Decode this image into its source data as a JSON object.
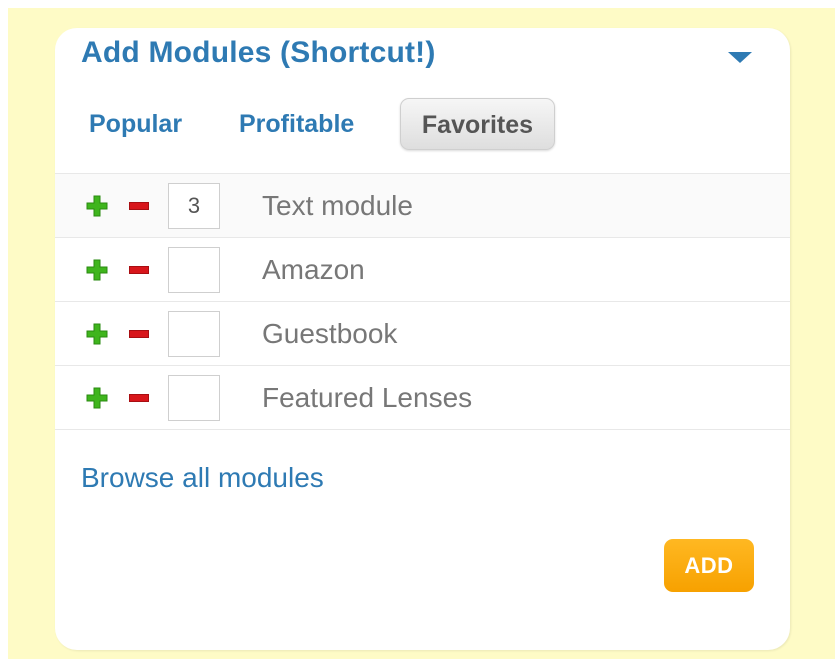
{
  "panel": {
    "title": "Add Modules (Shortcut!)",
    "collapse_icon": "triangle-down-icon"
  },
  "tabs": [
    {
      "label": "Popular",
      "active": false
    },
    {
      "label": "Profitable",
      "active": false
    },
    {
      "label": "Favorites",
      "active": true
    }
  ],
  "modules": [
    {
      "name": "Text module",
      "quantity": "3"
    },
    {
      "name": "Amazon",
      "quantity": ""
    },
    {
      "name": "Guestbook",
      "quantity": ""
    },
    {
      "name": "Featured Lenses",
      "quantity": ""
    }
  ],
  "icons": {
    "plus": "plus-icon",
    "minus": "minus-icon"
  },
  "browse_link": "Browse all modules",
  "add_button": "ADD",
  "colors": {
    "background": "#fefbc6",
    "accent": "#2e7ab3",
    "add_button": "#f7a100",
    "plus": "#3fb51d",
    "minus": "#d8161b"
  }
}
